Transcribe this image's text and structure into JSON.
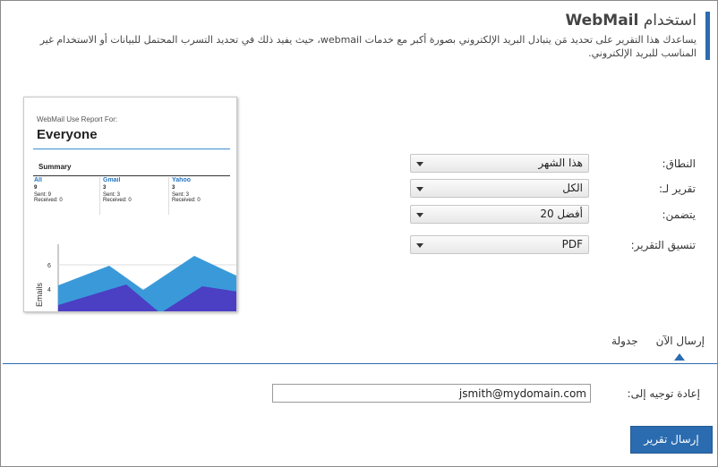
{
  "header": {
    "title_prefix": "استخدام",
    "title_brand": "WebMail",
    "description": "يساعدك هذا التقرير على تحديد مَن يتبادل البريد الإلكتروني بصورة أكبر مع خدمات webmail، حيث يفيد ذلك في تحديد التسرب المحتمل للبيانات أو الاستخدام غير المناسب للبريد الإلكتروني."
  },
  "preview": {
    "caption": "WebMail Use Report For:",
    "title": "Everyone",
    "summary_label": "Summary",
    "columns": [
      {
        "name": "All",
        "count": "9",
        "sent": "Sent: 9",
        "received": "Received: 0"
      },
      {
        "name": "Gmail",
        "count": "3",
        "sent": "Sent: 3",
        "received": "Received: 0"
      },
      {
        "name": "Yahoo",
        "count": "3",
        "sent": "Sent: 3",
        "received": "Received: 0"
      }
    ],
    "chart": {
      "ylabel": "Emails",
      "ticks": [
        "6",
        "4"
      ],
      "series_colors": [
        "#3a9ad9",
        "#4b3fc4"
      ]
    }
  },
  "form": {
    "scope": {
      "label": "النطاق:",
      "value": "هذا الشهر"
    },
    "report_for": {
      "label": "تقرير لـ:",
      "value": "الكل"
    },
    "includes": {
      "label": "يتضمن:",
      "value": "أفضل 20"
    },
    "format": {
      "label": "تنسيق التقرير:",
      "value": "PDF"
    }
  },
  "tabs": {
    "send_now": "إرسال الآن",
    "schedule": "جدولة"
  },
  "redirect": {
    "label": "إعادة توجيه إلى:",
    "value": "jsmith@mydomain.com"
  },
  "send_button": "إرسال تقرير",
  "colors": {
    "accent": "#2b6cb0",
    "chart_light": "#3a9ad9",
    "chart_dark": "#4b3fc4"
  }
}
